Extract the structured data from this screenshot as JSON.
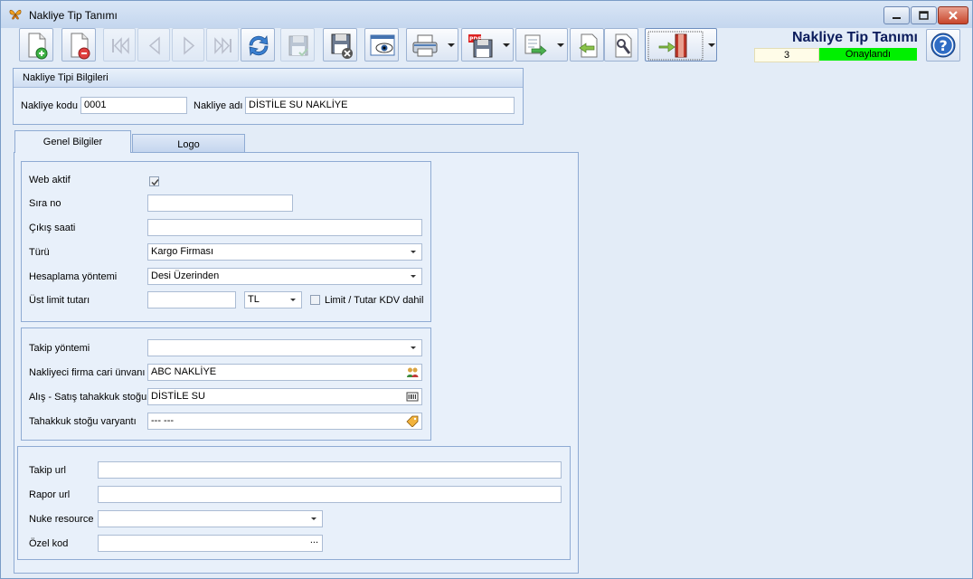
{
  "window": {
    "title": "Nakliye Tip Tanımı"
  },
  "toolbar": {
    "buttons": [
      {
        "icon": "new-document-icon"
      },
      {
        "icon": "delete-document-icon"
      },
      {
        "icon": "first-record-icon"
      },
      {
        "icon": "previous-record-icon"
      },
      {
        "icon": "next-record-icon"
      },
      {
        "icon": "last-record-icon"
      },
      {
        "icon": "refresh-icon"
      },
      {
        "icon": "save-icon"
      },
      {
        "icon": "cancel-save-icon"
      },
      {
        "icon": "preview-icon"
      },
      {
        "icon": "printer-icon"
      },
      {
        "icon": "pdf-export-icon"
      },
      {
        "icon": "export-icon"
      },
      {
        "icon": "import-icon"
      },
      {
        "icon": "tools-icon"
      },
      {
        "icon": "exit-door-icon"
      }
    ]
  },
  "header": {
    "title": "Nakliye Tip Tanımı",
    "count": "3",
    "status": "Onaylandı",
    "status_color": "#00f000"
  },
  "info_group": {
    "caption": "Nakliye Tipi Bilgileri",
    "code_label": "Nakliye kodu",
    "code_value": "0001",
    "name_label": "Nakliye adı",
    "name_value": "DİSTİLE SU NAKLİYE"
  },
  "tabs": [
    {
      "label": "Genel Bilgiler"
    },
    {
      "label": "Logo"
    }
  ],
  "general": {
    "web_active_label": "Web aktif",
    "web_active_checked": true,
    "sira_label": "Sıra no",
    "sira_value": "",
    "cikis_label": "Çıkış saati",
    "cikis_value": "",
    "turu_label": "Türü",
    "turu_value": "Kargo Firması",
    "hesap_label": "Hesaplama yöntemi",
    "hesap_value": "Desi Üzerinden",
    "ust_label": "Üst limit tutarı",
    "ust_value": "",
    "currency_value": "TL",
    "kdv_label": "Limit / Tutar KDV dahil",
    "kdv_checked": false
  },
  "tracking": {
    "takip_yontemi_label": "Takip yöntemi",
    "takip_yontemi_value": "",
    "firma_label": "Nakliyeci firma cari ünvanı",
    "firma_value": "ABC NAKLİYE",
    "stok_label": "Alış - Satış tahakkuk stoğu",
    "stok_value": "DİSTİLE SU",
    "varyant_label": "Tahakkuk stoğu varyantı",
    "varyant_value": "--- ---"
  },
  "urls": {
    "takip_url_label": "Takip url",
    "takip_url_value": "",
    "rapor_url_label": "Rapor url",
    "rapor_url_value": "",
    "nuke_label": "Nuke resource",
    "nuke_value": "",
    "ozel_label": "Özel kod",
    "ozel_value": "",
    "ozel_button": "..."
  }
}
